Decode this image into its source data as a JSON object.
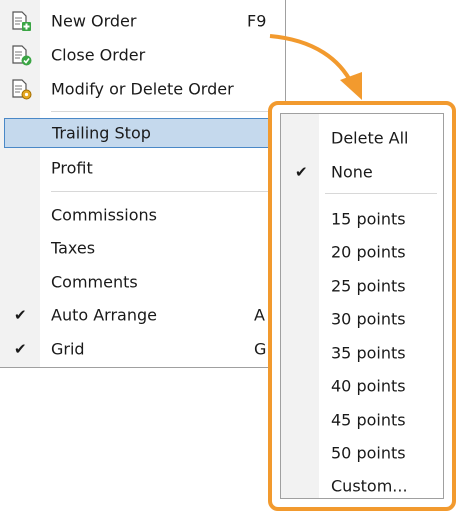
{
  "main_menu": {
    "items": [
      {
        "label": "New Order",
        "shortcut": "F9",
        "icon": "new-order-icon"
      },
      {
        "label": "Close Order",
        "icon": "close-order-icon"
      },
      {
        "label": "Modify or Delete Order",
        "icon": "modify-order-icon"
      },
      {
        "label": "Trailing Stop",
        "highlighted": true
      },
      {
        "label": "Profit"
      },
      {
        "label": "Commissions"
      },
      {
        "label": "Taxes"
      },
      {
        "label": "Comments"
      },
      {
        "label": "Auto Arrange",
        "shortcut": "A",
        "checked": true
      },
      {
        "label": "Grid",
        "shortcut": "G",
        "checked": true
      }
    ]
  },
  "check_glyph": "✔",
  "submenu": {
    "items": [
      {
        "label": "Delete All"
      },
      {
        "label": "None",
        "checked": true
      },
      {
        "label": "15 points"
      },
      {
        "label": "20 points"
      },
      {
        "label": "25 points"
      },
      {
        "label": "30 points"
      },
      {
        "label": "35 points"
      },
      {
        "label": "40 points"
      },
      {
        "label": "45 points"
      },
      {
        "label": "50 points"
      },
      {
        "label": "Custom..."
      }
    ]
  },
  "colors": {
    "highlight_outline": "#f29a2e",
    "selection": "#c5d9ed",
    "selection_border": "#4a88c7"
  }
}
